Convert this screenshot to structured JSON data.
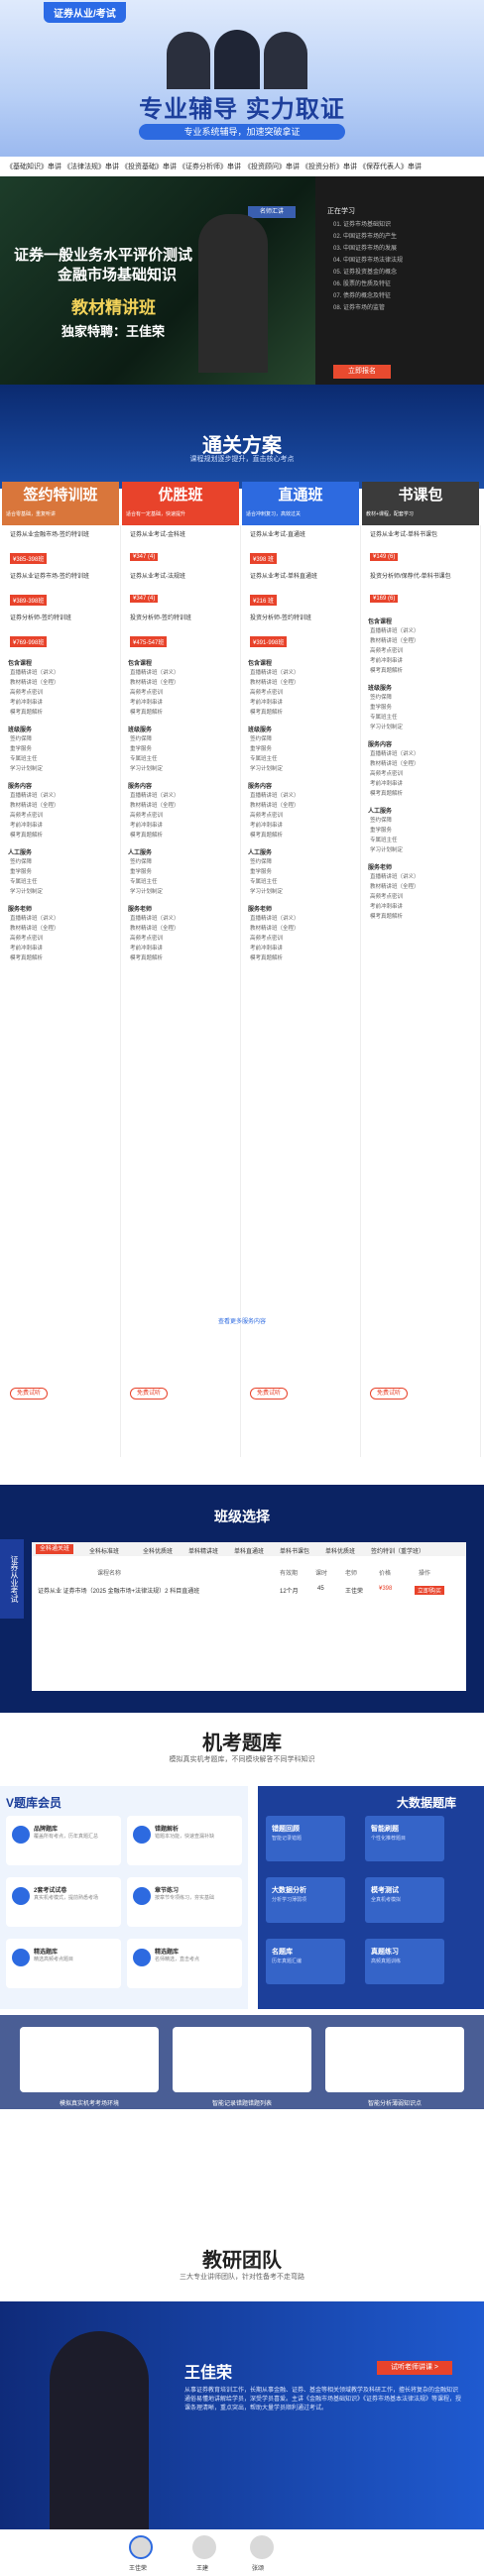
{
  "brand": {
    "logo": "证券从业/考试"
  },
  "hero": {
    "slogan": "专业辅导 实力取证",
    "sub": "专业系统辅导，加速突破拿证"
  },
  "nav": {
    "items": [
      "《基础知识》串讲",
      "《法律法规》串讲",
      "《投资基础》串讲",
      "《证券分析师》串讲",
      "《投资顾问》串讲",
      "《投资分析》串讲",
      "《保荐代表人》串讲"
    ]
  },
  "video": {
    "title1": "证券一般业务水平评价测试",
    "title2": "金融市场基础知识",
    "title3": "教材精讲班",
    "title4": "独家特聘：王佳荣",
    "badge": "名师汇讲",
    "playlist_title": "正在学习",
    "playlist": [
      "01.  证券市场基础知识",
      "02.  中国证券市场的产生",
      "03.  中国证券市场的发展",
      "04.  中国证券市场法律法规",
      "05.  证券投资基金的概念",
      "06.  股票的性质及特征",
      "07.  债券的概念及特征",
      "08.  证券市场的监管"
    ],
    "cta": "立即报名"
  },
  "plan": {
    "title": "通关方案",
    "subtitle": "课程规划逐步提升，直击核心考点",
    "columns": [
      {
        "name": "签约特训班",
        "color": "#d9763b",
        "band": "适合零基础，重复听讲",
        "products": [
          [
            "证券从业金融市场-签约特训班",
            "¥385-398班"
          ],
          [
            "证券从业证券市场-签约特训班",
            "¥389-398班"
          ],
          [
            "证券分析师-签约特训班",
            "¥769-998班"
          ]
        ]
      },
      {
        "name": "优胜班",
        "color": "#e8432b",
        "band": "适合有一定基础，快速提升",
        "products": [
          [
            "证券从业考试-金科班",
            "¥347 (4)"
          ],
          [
            "证券从业考试-法规班",
            "¥347 (4)"
          ],
          [
            "投资分析师-签约特训班",
            "¥475-547班"
          ]
        ]
      },
      {
        "name": "直通班",
        "color": "#2d6ae0",
        "band": "适合冲刺复习，高效过关",
        "products": [
          [
            "证券从业考试-直通班",
            "¥398 班"
          ],
          [
            "证券从业考试-单科直通班",
            "¥216 班"
          ],
          [
            "投资分析师-签约特训班",
            "¥391-998班"
          ]
        ]
      },
      {
        "name": "书课包",
        "color": "#3b3b3b",
        "band": "教材+课程，配套学习",
        "products": [
          [
            "证券从业考试-单科书课包",
            "¥149 (6)"
          ],
          [
            "投资分析师/保荐代-单科书课包",
            "¥169 (6)"
          ],
          [
            "",
            ""
          ]
        ]
      }
    ],
    "sections": [
      "包含课程",
      "班级服务",
      "服务内容",
      "人工服务",
      "服务老师"
    ],
    "course_lines": [
      "直播精讲班（讲义）",
      "教材精讲班（全程）",
      "高频考点密训",
      "考前冲刺串讲",
      "模考真题解析"
    ],
    "service_lines": [
      "签约保障",
      "重学服务",
      "专属班主任",
      "学习计划制定"
    ],
    "free_label": "免费试听",
    "more_label": "查看更多服务内容"
  },
  "select": {
    "title": "班级选择",
    "side": "证券从业考试",
    "tabs": [
      "全科通关班",
      "全科标准班",
      "全科优质班",
      "单科精讲班",
      "单科直通班",
      "单科书课包",
      "单科优质班",
      "签约特训（重学班）"
    ],
    "head": [
      "课程名称",
      "有效期",
      "课时",
      "老师",
      "价格",
      "操作"
    ],
    "row": [
      "证券从业 证券市场（2025 金融市场+法律法规）2 科目直通班",
      "12个月",
      "45",
      "王佳荣",
      "¥398",
      "立即购买"
    ]
  },
  "bank": {
    "title": "机考题库",
    "subtitle": "模拟真实机考题库，不同模块解答不同学科知识",
    "vip_title": "V题库会员",
    "vip_items": [
      [
        "品牌题库",
        "覆盖所有考点，历年真题汇总"
      ],
      [
        "错题解析",
        "错题本功能，快速查漏补缺"
      ],
      [
        "2套考试试卷",
        "真实机考模式，提前熟悉考场"
      ],
      [
        "章节练习",
        "按章节专项练习，夯实基础"
      ],
      [
        "精选题库",
        "精选高频考点题目"
      ],
      [
        "精选题库",
        "名师精选，直击考点"
      ]
    ],
    "big_title": "大数据题库",
    "big_items": [
      [
        "错题回顾",
        "智能记录错题"
      ],
      [
        "智能刷题",
        "个性化推荐题目"
      ],
      [
        "大数据分析",
        "分析学习薄弱项"
      ],
      [
        "模考测试",
        "全真机考模拟"
      ],
      [
        "名题库",
        "历年真题汇编"
      ],
      [
        "真题练习",
        "高频真题训练"
      ]
    ],
    "shots": [
      "模拟真实机考考场环境",
      "智能记录错题错题列表",
      "智能分析薄弱知识点"
    ]
  },
  "team": {
    "title": "教研团队",
    "subtitle": "三大专业讲师团队，针对性备考不走弯路",
    "teacher": "王佳荣",
    "btn": "试听老师讲课 >",
    "desc": "从事证券教育培训工作，长期从事金融、证券、基金等相关领域教学及科研工作，擅长将复杂的金融知识通俗易懂地讲解给学员，深受学员喜爱。主讲《金融市场基础知识》《证券市场基本法律法规》等课程，授课条理清晰，重点突出，帮助大量学员顺利通过考试。",
    "thumbs": [
      "王佳荣",
      "王建",
      "张颂"
    ]
  }
}
